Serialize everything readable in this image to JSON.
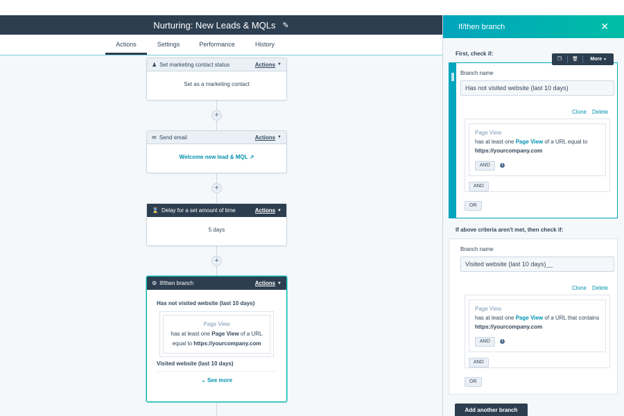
{
  "header": {
    "title": "Nurturing: New Leads & MQLs",
    "edit_icon": "pencil-icon"
  },
  "tabs": [
    {
      "label": "Actions",
      "active": true
    },
    {
      "label": "Settings",
      "active": false
    },
    {
      "label": "Performance",
      "active": false
    },
    {
      "label": "History",
      "active": false
    }
  ],
  "workflow": {
    "actions_label": "Actions",
    "plus_symbol": "+",
    "steps": [
      {
        "icon": "person-icon",
        "title": "Set marketing contact status",
        "body": "Set as a marketing contact"
      },
      {
        "icon": "mail-icon",
        "title": "Send email",
        "body": "Welcome new lead & MQL"
      },
      {
        "icon": "hourglass-icon",
        "title": "Delay for a set amount of time",
        "body": "5 days"
      },
      {
        "icon": "branch-icon",
        "title": "If/then branch",
        "branch1_name": "Has not visited website (last 10 days)",
        "branch1_pv_title": "Page View",
        "branch1_pv_pre": "has at least one",
        "branch1_pv_bold": "Page View",
        "branch1_pv_mid": "of a URL",
        "branch1_pv_line2_pre": "equal to",
        "branch1_pv_url": "https://yourcompany.com",
        "branch2_name": "Visited website (last 10 days)",
        "see_more": "See more"
      }
    ]
  },
  "panel": {
    "title": "If/then branch",
    "first_check_label": "First, check if:",
    "else_check_label": "If above criteria aren't met, then check if:",
    "toolbar": {
      "more_label": "More"
    },
    "branch_name_label": "Branch name",
    "clone_label": "Clone",
    "delete_label": "Delete",
    "and_label": "AND",
    "or_label": "OR",
    "branches": [
      {
        "name": "Has not visited website (last 10 days)",
        "pv_title": "Page View",
        "pv_pre": "has at least one",
        "pv_bold": "Page View",
        "pv_post": "of a URL equal to",
        "pv_url": "https://yourcompany.com"
      },
      {
        "name": "Visited website (last 10 days)__",
        "pv_title": "Page View",
        "pv_pre": "has at least one",
        "pv_bold": "Page View",
        "pv_post": "of a URL that contains",
        "pv_url": "https://yourcompany.com"
      }
    ],
    "add_branch_label": "Add another branch"
  },
  "colors": {
    "navy": "#2d3e50",
    "teal": "#00a4bd",
    "link": "#0091ae",
    "canvas": "#f5f8fa"
  }
}
